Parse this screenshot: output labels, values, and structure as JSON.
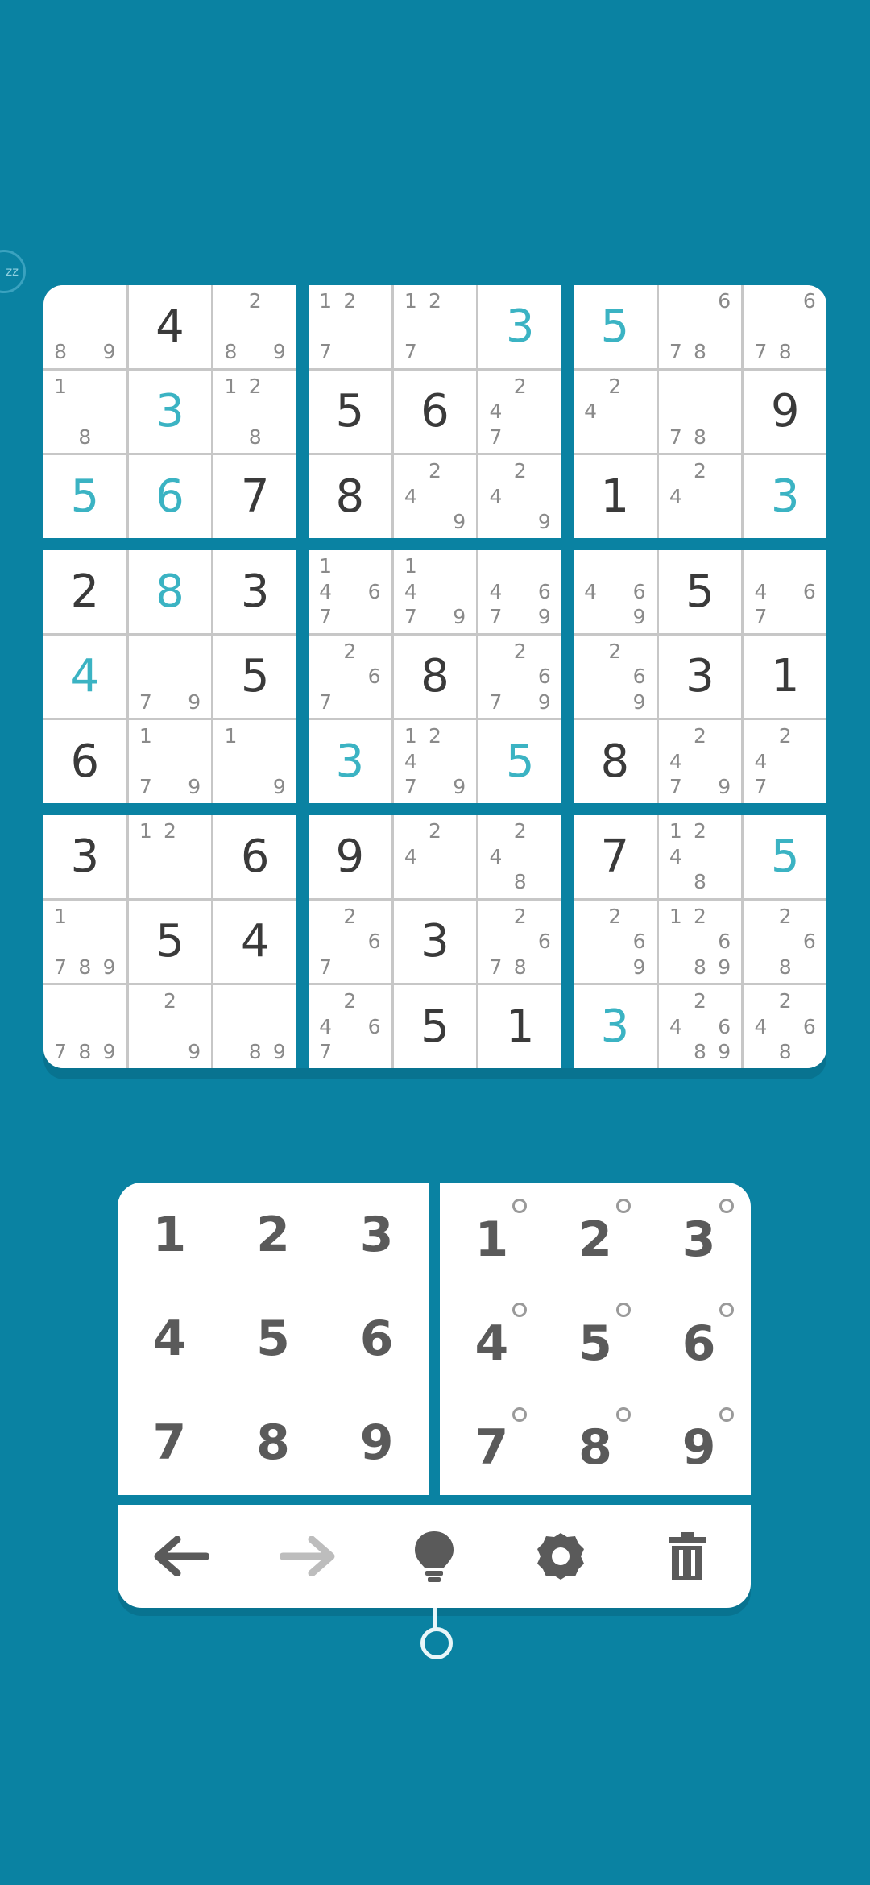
{
  "sleep_badge": "zz",
  "board": {
    "cells": [
      [
        {
          "n": [
            "",
            "",
            "",
            "",
            "",
            "",
            "8",
            "",
            "9"
          ]
        },
        {
          "v": "4"
        },
        {
          "n": [
            "",
            "2",
            "",
            "",
            "",
            "",
            "8",
            "",
            "9"
          ]
        },
        {
          "n": [
            "1",
            "2",
            "",
            "",
            "",
            "",
            "7",
            "",
            ""
          ]
        },
        {
          "n": [
            "1",
            "2",
            "",
            "",
            "",
            "",
            "7",
            "",
            ""
          ]
        },
        {
          "v": "3",
          "u": true
        },
        {
          "v": "5",
          "u": true
        },
        {
          "n": [
            "",
            "",
            "6",
            "",
            "",
            "",
            "7",
            "8",
            ""
          ]
        },
        {
          "n": [
            "",
            "",
            "6",
            "",
            "",
            "",
            "7",
            "8",
            ""
          ]
        }
      ],
      [
        {
          "n": [
            "1",
            "",
            "",
            "",
            "",
            "",
            "",
            "8",
            ""
          ]
        },
        {
          "v": "3",
          "u": true
        },
        {
          "n": [
            "1",
            "2",
            "",
            "",
            "",
            "",
            "",
            "8",
            ""
          ]
        },
        {
          "v": "5"
        },
        {
          "v": "6"
        },
        {
          "n": [
            "",
            "2",
            "",
            "4",
            "",
            "",
            "7",
            "",
            ""
          ]
        },
        {
          "n": [
            "",
            "2",
            "",
            "4",
            "",
            "",
            "",
            "",
            ""
          ]
        },
        {
          "n": [
            "",
            "",
            "",
            "",
            "",
            "",
            "7",
            "8",
            ""
          ]
        },
        {
          "v": "9"
        }
      ],
      [
        {
          "v": "5",
          "u": true
        },
        {
          "v": "6",
          "u": true
        },
        {
          "v": "7"
        },
        {
          "v": "8"
        },
        {
          "n": [
            "",
            "2",
            "",
            "4",
            "",
            "",
            "",
            "",
            "9"
          ]
        },
        {
          "n": [
            "",
            "2",
            "",
            "4",
            "",
            "",
            "",
            "",
            "9"
          ]
        },
        {
          "v": "1"
        },
        {
          "n": [
            "",
            "2",
            "",
            "4",
            "",
            "",
            "",
            "",
            ""
          ]
        },
        {
          "v": "3",
          "u": true
        }
      ],
      [
        {
          "v": "2"
        },
        {
          "v": "8",
          "u": true
        },
        {
          "v": "3"
        },
        {
          "n": [
            "1",
            "",
            "",
            "4",
            "",
            "6",
            "7",
            "",
            ""
          ]
        },
        {
          "n": [
            "1",
            "",
            "",
            "4",
            "",
            "",
            "7",
            "",
            "9"
          ]
        },
        {
          "n": [
            "",
            "",
            "",
            "4",
            "",
            "6",
            "7",
            "",
            "9"
          ]
        },
        {
          "n": [
            "",
            "",
            "",
            "4",
            "",
            "6",
            "",
            "",
            "9"
          ]
        },
        {
          "v": "5"
        },
        {
          "n": [
            "",
            "",
            "",
            "4",
            "",
            "6",
            "7",
            "",
            ""
          ]
        }
      ],
      [
        {
          "v": "4",
          "u": true
        },
        {
          "n": [
            "",
            "",
            "",
            "",
            "",
            "",
            "7",
            "",
            "9"
          ]
        },
        {
          "v": "5"
        },
        {
          "n": [
            "",
            "2",
            "",
            "",
            "",
            "6",
            "7",
            "",
            ""
          ]
        },
        {
          "v": "8"
        },
        {
          "n": [
            "",
            "2",
            "",
            "",
            "",
            "6",
            "7",
            "",
            "9"
          ]
        },
        {
          "n": [
            "",
            "2",
            "",
            "",
            "",
            "6",
            "",
            "",
            "9"
          ]
        },
        {
          "v": "3"
        },
        {
          "v": "1"
        }
      ],
      [
        {
          "v": "6"
        },
        {
          "n": [
            "1",
            "",
            "",
            "",
            "",
            "",
            "7",
            "",
            "9"
          ]
        },
        {
          "n": [
            "1",
            "",
            "",
            "",
            "",
            "",
            "",
            "",
            "9"
          ]
        },
        {
          "v": "3",
          "u": true
        },
        {
          "n": [
            "1",
            "2",
            "",
            "4",
            "",
            "",
            "7",
            "",
            "9"
          ]
        },
        {
          "v": "5",
          "u": true
        },
        {
          "v": "8"
        },
        {
          "n": [
            "",
            "2",
            "",
            "4",
            "",
            "",
            "7",
            "",
            "9"
          ]
        },
        {
          "n": [
            "",
            "2",
            "",
            "4",
            "",
            "",
            "7",
            "",
            ""
          ]
        }
      ],
      [
        {
          "v": "3"
        },
        {
          "n": [
            "1",
            "2",
            "",
            "",
            "",
            "",
            "",
            "",
            ""
          ]
        },
        {
          "v": "6"
        },
        {
          "v": "9"
        },
        {
          "n": [
            "",
            "2",
            "",
            "4",
            "",
            "",
            "",
            "",
            ""
          ]
        },
        {
          "n": [
            "",
            "2",
            "",
            "4",
            "",
            "",
            "",
            "8",
            ""
          ]
        },
        {
          "v": "7"
        },
        {
          "n": [
            "1",
            "2",
            "",
            "4",
            "",
            "",
            "",
            "8",
            ""
          ]
        },
        {
          "v": "5",
          "u": true
        }
      ],
      [
        {
          "n": [
            "1",
            "",
            "",
            "",
            "",
            "",
            "7",
            "8",
            "9"
          ]
        },
        {
          "v": "5"
        },
        {
          "v": "4"
        },
        {
          "n": [
            "",
            "2",
            "",
            "",
            "",
            "6",
            "7",
            "",
            ""
          ]
        },
        {
          "v": "3"
        },
        {
          "n": [
            "",
            "2",
            "",
            "",
            "",
            "6",
            "7",
            "8",
            ""
          ]
        },
        {
          "n": [
            "",
            "2",
            "",
            "",
            "",
            "6",
            "",
            "",
            "9"
          ]
        },
        {
          "n": [
            "1",
            "2",
            "",
            "",
            "",
            "6",
            "",
            "8",
            "9"
          ]
        },
        {
          "n": [
            "",
            "2",
            "",
            "",
            "",
            "6",
            "",
            "8",
            ""
          ]
        }
      ],
      [
        {
          "n": [
            "",
            "",
            "",
            "",
            "",
            "",
            "7",
            "8",
            "9"
          ]
        },
        {
          "n": [
            "",
            "2",
            "",
            "",
            "",
            "",
            "",
            "",
            "9"
          ]
        },
        {
          "n": [
            "",
            "",
            "",
            "",
            "",
            "",
            "",
            "8",
            "9"
          ]
        },
        {
          "n": [
            "",
            "2",
            "",
            "4",
            "",
            "6",
            "7",
            "",
            ""
          ]
        },
        {
          "v": "5"
        },
        {
          "v": "1"
        },
        {
          "v": "3",
          "u": true
        },
        {
          "n": [
            "",
            "2",
            "",
            "4",
            "",
            "6",
            "",
            "8",
            "9"
          ]
        },
        {
          "n": [
            "",
            "2",
            "",
            "4",
            "",
            "6",
            "",
            "8",
            ""
          ]
        }
      ]
    ]
  },
  "pad_values": [
    "1",
    "2",
    "3",
    "4",
    "5",
    "6",
    "7",
    "8",
    "9"
  ],
  "pad_notes": [
    "1",
    "2",
    "3",
    "4",
    "5",
    "6",
    "7",
    "8",
    "9"
  ],
  "toolbar": [
    {
      "name": "undo-icon",
      "color": "#5a5a5a"
    },
    {
      "name": "redo-icon",
      "color": "#bdbdbd"
    },
    {
      "name": "hint-bulb-icon",
      "color": "#5a5a5a"
    },
    {
      "name": "settings-gear-icon",
      "color": "#5a5a5a"
    },
    {
      "name": "delete-trash-icon",
      "color": "#5a5a5a"
    }
  ],
  "colors": {
    "background": "#0a82a2",
    "user_digit": "#3bb3c3",
    "given_digit": "#3a3a3a",
    "note": "#8a8a8a"
  }
}
